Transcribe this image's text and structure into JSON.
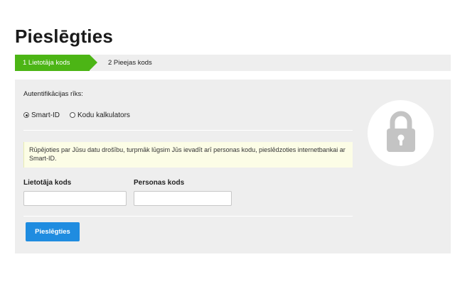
{
  "page": {
    "title": "Pieslēgties"
  },
  "steps": {
    "active": "1  Lietotāja kods",
    "inactive": "2  Pieejas kods"
  },
  "auth": {
    "label": "Autentifikācijas rīks:",
    "options": [
      "Smart-ID",
      "Kodu kalkulators"
    ],
    "selected": "Smart-ID"
  },
  "notice": {
    "text": "Rūpējoties par Jūsu datu drošību, turpmāk lūgsim Jūs ievadīt arī personas kodu, pieslēdzoties internetbankai ar Smart-ID."
  },
  "form": {
    "username_label": "Lietotāja kods",
    "username_value": "",
    "personal_code_label": "Personas kods",
    "personal_code_value": "",
    "submit_label": "Pieslēgties"
  },
  "icons": {
    "lock": "lock-icon"
  },
  "colors": {
    "step_active": "#4cb515",
    "button": "#1f8ce0",
    "panel": "#eeeeee"
  }
}
